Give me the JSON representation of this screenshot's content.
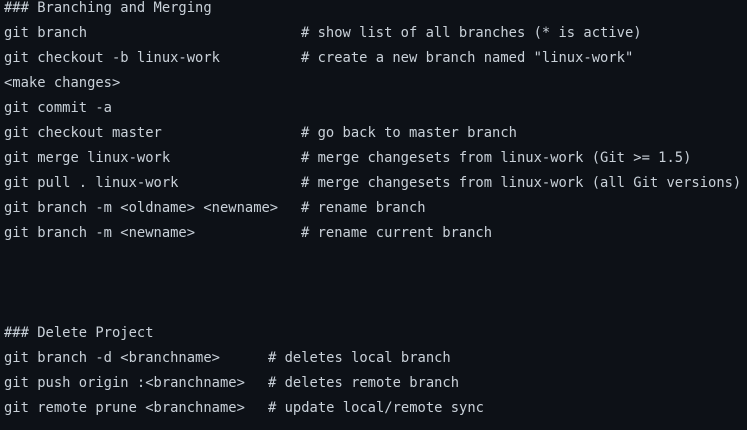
{
  "sections": [
    {
      "heading": "### Branching and Merging",
      "lines": [
        {
          "cmd": "git branch",
          "comment": "# show list of all branches (* is active)"
        },
        {
          "cmd": "git checkout -b linux-work",
          "comment": "# create a new branch named \"linux-work\""
        },
        {
          "cmd": "<make changes>",
          "comment": ""
        },
        {
          "cmd": "git commit -a",
          "comment": ""
        },
        {
          "cmd": "git checkout master",
          "comment": "# go back to master branch"
        },
        {
          "cmd": "git merge linux-work",
          "comment": "# merge changesets from linux-work (Git >= 1.5)"
        },
        {
          "cmd": "git pull . linux-work",
          "comment": "# merge changesets from linux-work (all Git versions)"
        },
        {
          "cmd": "git branch -m <oldname> <newname>",
          "comment": "# rename branch"
        },
        {
          "cmd": "git branch -m <newname>",
          "comment": "# rename current branch"
        }
      ]
    },
    {
      "heading": "### Delete Project",
      "lines": [
        {
          "cmd": "git branch -d <branchname>",
          "comment": "# deletes local branch"
        },
        {
          "cmd": "git push origin :<branchname>",
          "comment": "# deletes remote branch"
        },
        {
          "cmd": "git remote prune <branchname>",
          "comment": "# update local/remote sync"
        }
      ]
    }
  ],
  "colors": {
    "background": "#0d1117",
    "text": "#c9d1d9"
  }
}
